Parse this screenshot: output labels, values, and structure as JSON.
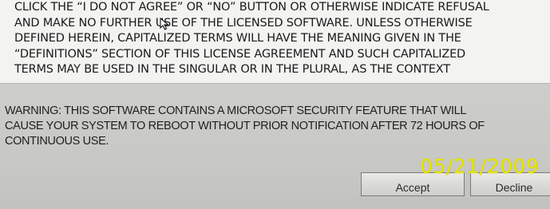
{
  "license": {
    "lines": [
      "CLICK THE “I DO NOT AGREE” OR “NO” BUTTON OR OTHERWISE INDICATE REFUSAL",
      "AND MAKE NO FURTHER USE OF THE LICENSED SOFTWARE. UNLESS OTHERWISE",
      "DEFINED HEREIN, CAPITALIZED TERMS WILL HAVE THE MEANING GIVEN IN THE",
      "“DEFINITIONS” SECTION OF THIS LICENSE AGREEMENT AND SUCH CAPITALIZED",
      "TERMS MAY BE USED IN THE SINGULAR OR IN THE PLURAL, AS THE CONTEXT"
    ]
  },
  "warning": {
    "lines": [
      "WARNING: THIS SOFTWARE CONTAINS A MICROSOFT SECURITY FEATURE THAT WILL",
      "CAUSE YOUR SYSTEM TO REBOOT WITHOUT PRIOR NOTIFICATION AFTER 72 HOURS OF",
      "CONTINUOUS USE."
    ]
  },
  "buttons": {
    "accept_label": "Accept",
    "decline_label": "Decline"
  },
  "photo": {
    "date_stamp": "05/21/2009",
    "date_stamp_color": "#e6e600"
  }
}
